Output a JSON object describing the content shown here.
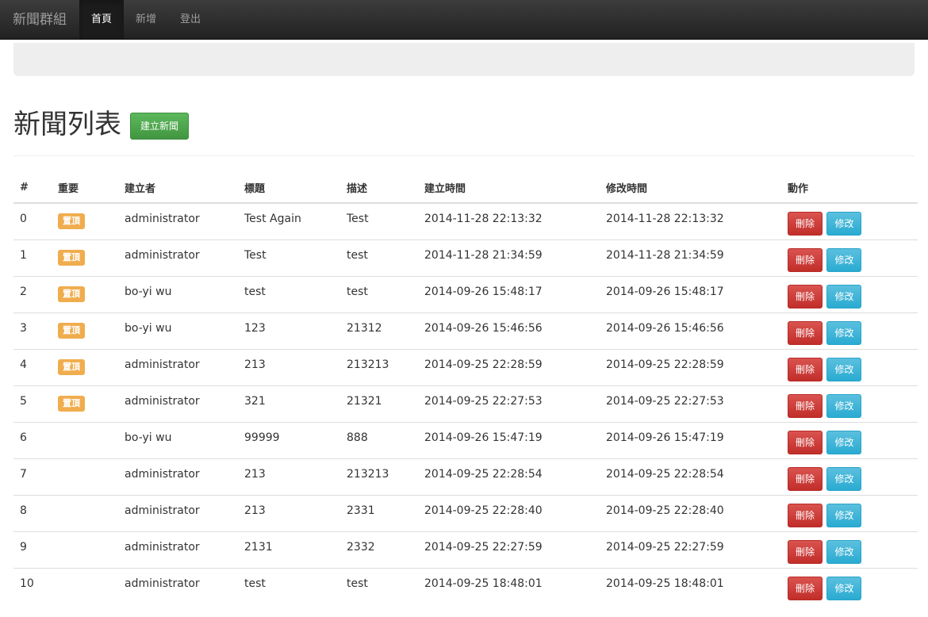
{
  "nav": {
    "brand": "新聞群組",
    "items": [
      {
        "label": "首頁"
      },
      {
        "label": "新增"
      },
      {
        "label": "登出"
      }
    ]
  },
  "header": {
    "title": "新聞列表",
    "create_button": "建立新聞"
  },
  "table": {
    "columns": [
      "#",
      "重要",
      "建立者",
      "標題",
      "描述",
      "建立時間",
      "修改時間",
      "動作"
    ],
    "delete_label": "刪除",
    "edit_label": "修改",
    "top_label": "置頂",
    "rows": [
      {
        "id": "0",
        "top": true,
        "author": "administrator",
        "title": "Test Again",
        "desc": "Test",
        "created": "2014-11-28 22:13:32",
        "modified": "2014-11-28 22:13:32"
      },
      {
        "id": "1",
        "top": true,
        "author": "administrator",
        "title": "Test",
        "desc": "test",
        "created": "2014-11-28 21:34:59",
        "modified": "2014-11-28 21:34:59"
      },
      {
        "id": "2",
        "top": true,
        "author": "bo-yi wu",
        "title": "test",
        "desc": "test",
        "created": "2014-09-26 15:48:17",
        "modified": "2014-09-26 15:48:17"
      },
      {
        "id": "3",
        "top": true,
        "author": "bo-yi wu",
        "title": "123",
        "desc": "21312",
        "created": "2014-09-26 15:46:56",
        "modified": "2014-09-26 15:46:56"
      },
      {
        "id": "4",
        "top": true,
        "author": "administrator",
        "title": "213",
        "desc": "213213",
        "created": "2014-09-25 22:28:59",
        "modified": "2014-09-25 22:28:59"
      },
      {
        "id": "5",
        "top": true,
        "author": "administrator",
        "title": "321",
        "desc": "21321",
        "created": "2014-09-25 22:27:53",
        "modified": "2014-09-25 22:27:53"
      },
      {
        "id": "6",
        "top": false,
        "author": "bo-yi wu",
        "title": "99999",
        "desc": "888",
        "created": "2014-09-26 15:47:19",
        "modified": "2014-09-26 15:47:19"
      },
      {
        "id": "7",
        "top": false,
        "author": "administrator",
        "title": "213",
        "desc": "213213",
        "created": "2014-09-25 22:28:54",
        "modified": "2014-09-25 22:28:54"
      },
      {
        "id": "8",
        "top": false,
        "author": "administrator",
        "title": "213",
        "desc": "2331",
        "created": "2014-09-25 22:28:40",
        "modified": "2014-09-25 22:28:40"
      },
      {
        "id": "9",
        "top": false,
        "author": "administrator",
        "title": "2131",
        "desc": "2332",
        "created": "2014-09-25 22:27:59",
        "modified": "2014-09-25 22:27:59"
      },
      {
        "id": "10",
        "top": false,
        "author": "administrator",
        "title": "test",
        "desc": "test",
        "created": "2014-09-25 18:48:01",
        "modified": "2014-09-25 18:48:01"
      }
    ]
  }
}
